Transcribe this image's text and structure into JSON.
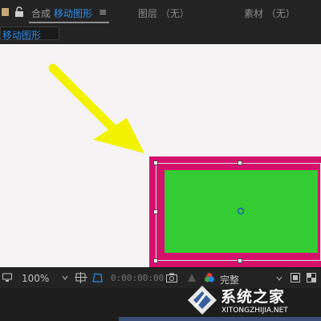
{
  "panels": {
    "composition_tab": {
      "prefix": "合成",
      "name": "移动图形",
      "menu_glyph": "≡"
    },
    "layer_tab": "图层 （无）",
    "footage_tab": "素材 （无）"
  },
  "breadcrumb": "移动图形",
  "viewer": {
    "background_color": "#f6f3f4",
    "shape_stroke_color": "#d5116e",
    "shape_fill_color": "#33cc33",
    "arrow_color": "#ffff00"
  },
  "toolbar": {
    "zoom": "100%",
    "timecode": "0:00:00:00",
    "resolution": "完整"
  },
  "watermark": {
    "title": "系统之家",
    "url": "XITONGZHIJIA.NET"
  },
  "colors": {
    "accent": "#2d8ceb",
    "panel_bg": "#232323",
    "timeline_bar": "#3a4e78"
  }
}
